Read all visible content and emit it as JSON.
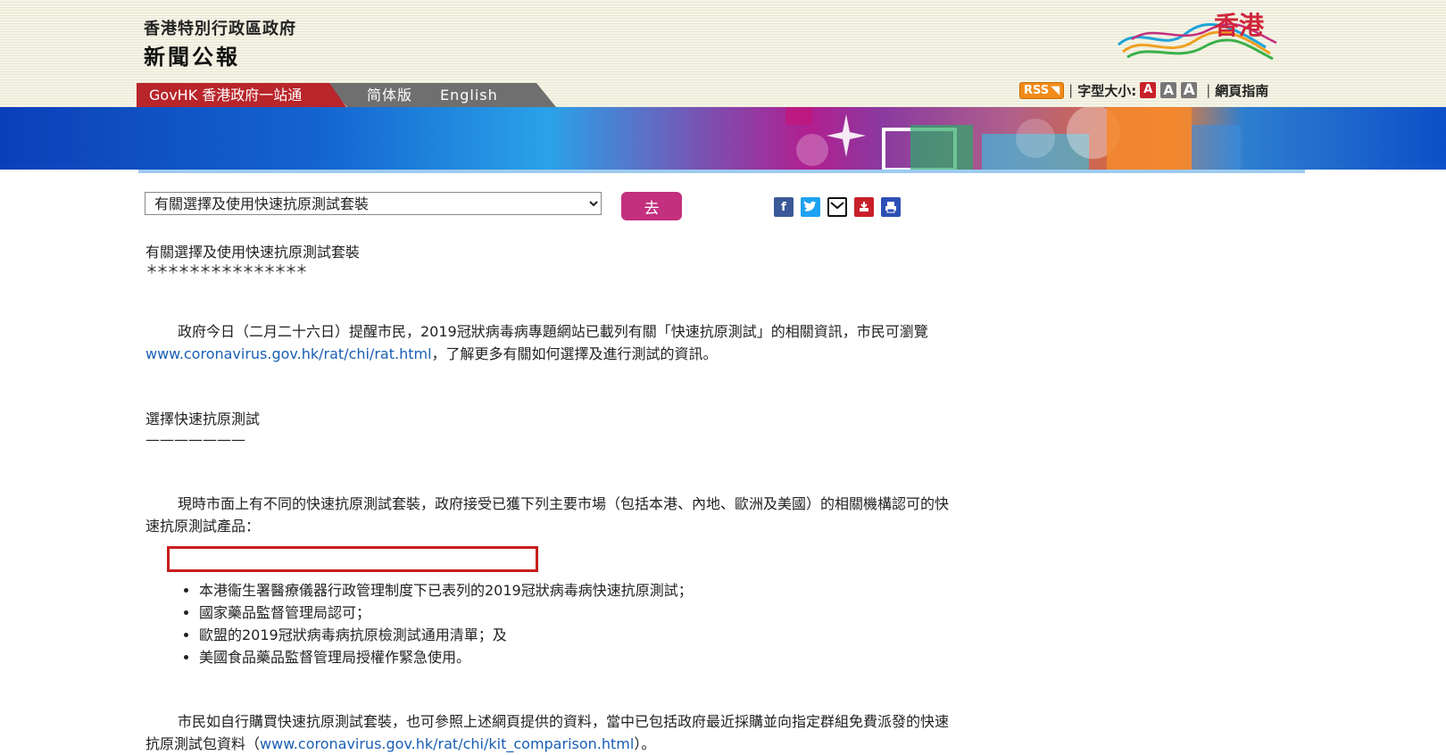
{
  "header": {
    "gov_name": "香港特別行政區政府",
    "site_title": "新聞公報",
    "tabs": [
      "GovHK 香港政府一站通",
      "简体版",
      "English"
    ],
    "rss": "RSS",
    "font_size_label": "字型大小:",
    "font_size_buttons": [
      "A",
      "A",
      "A"
    ],
    "guide": "網頁指南",
    "logo_text": "香港",
    "colors": {
      "brand_red": "#b8252a",
      "tab_grey": "#6f6f6f",
      "rss": "#f08c1a"
    }
  },
  "toolbar": {
    "select_value": "有關選擇及使用快速抗原測試套裝",
    "go_label": "去",
    "share_icons": [
      "facebook-icon",
      "twitter-icon",
      "email-icon",
      "download-icon",
      "print-icon"
    ]
  },
  "article": {
    "title": "有關選擇及使用快速抗原測試套裝",
    "stars": "＊＊＊＊＊＊＊＊＊＊＊＊＊＊＊",
    "p1_before": "政府今日（二月二十六日）提醒市民，2019冠狀病毒病專題網站已載列有關「快速抗原測試」的相關資訊，市民可瀏覽",
    "p1_link": "www.coronavirus.gov.hk/rat/chi/rat.html",
    "p1_after": "，了解更多有關如何選擇及進行測試的資訊。",
    "section_title": "選擇快速抗原測試",
    "section_rule": "———————",
    "p2": "現時市面上有不同的快速抗原測試套裝，政府接受已獲下列主要市場（包括本港、內地、歐洲及美國）的相關機構認可的快速抗原測試產品：",
    "list": [
      "本港衞生署醫療儀器行政管理制度下已表列的2019冠狀病毒病快速抗原測試；",
      "國家藥品監督管理局認可；",
      "歐盟的2019冠狀病毒病抗原檢測試通用清單；及",
      "美國食品藥品監督管理局授權作緊急使用。"
    ],
    "p3_before": "市民如自行購買快速抗原測試套裝，也可參照上述網頁提供的資料，當中已包括政府最近採購並向指定群組免費派發的快速抗原測試包資料（",
    "p3_link": "www.coronavirus.gov.hk/rat/chi/kit_comparison.html",
    "p3_after": "）。"
  }
}
